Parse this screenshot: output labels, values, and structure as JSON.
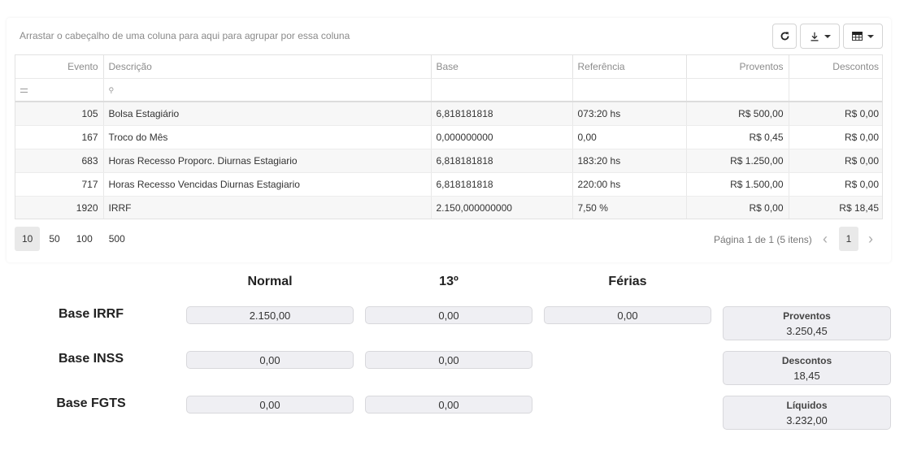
{
  "grid": {
    "group_hint": "Arrastar o cabeçalho de uma coluna para aqui para agrupar por essa coluna",
    "columns": [
      "Evento",
      "Descrição",
      "Base",
      "Referência",
      "Proventos",
      "Descontos"
    ],
    "rows": [
      {
        "evento": "105",
        "descricao": "Bolsa Estagiário",
        "base": "6,818181818",
        "referencia": "073:20 hs",
        "proventos": "R$ 500,00",
        "descontos": "R$ 0,00"
      },
      {
        "evento": "167",
        "descricao": "Troco do Mês",
        "base": "0,000000000",
        "referencia": "0,00",
        "proventos": "R$ 0,45",
        "descontos": "R$ 0,00"
      },
      {
        "evento": "683",
        "descricao": "Horas Recesso Proporc. Diurnas Estagiario",
        "base": "6,818181818",
        "referencia": "183:20 hs",
        "proventos": "R$ 1.250,00",
        "descontos": "R$ 0,00"
      },
      {
        "evento": "717",
        "descricao": "Horas Recesso Vencidas Diurnas Estagiario",
        "base": "6,818181818",
        "referencia": "220:00 hs",
        "proventos": "R$ 1.500,00",
        "descontos": "R$ 0,00"
      },
      {
        "evento": "1920",
        "descricao": "IRRF",
        "base": "2.150,000000000",
        "referencia": "7,50 %",
        "proventos": "R$ 0,00",
        "descontos": "R$ 18,45"
      }
    ]
  },
  "pager": {
    "sizes": [
      "10",
      "50",
      "100",
      "500"
    ],
    "active_size": "10",
    "info": "Página 1 de 1 (5 itens)",
    "current_page": "1"
  },
  "summary": {
    "columns": {
      "normal": "Normal",
      "decimo": "13º",
      "ferias": "Férias"
    },
    "rows": {
      "irrf": {
        "label": "Base IRRF",
        "normal": "2.150,00",
        "decimo": "0,00",
        "ferias": "0,00"
      },
      "inss": {
        "label": "Base INSS",
        "normal": "0,00",
        "decimo": "0,00"
      },
      "fgts": {
        "label": "Base FGTS",
        "normal": "0,00",
        "decimo": "0,00"
      }
    },
    "totals": {
      "proventos": {
        "label": "Proventos",
        "value": "3.250,45"
      },
      "descontos": {
        "label": "Descontos",
        "value": "18,45"
      },
      "liquidos": {
        "label": "Líquidos",
        "value": "3.232,00"
      }
    }
  },
  "icons": {
    "refresh": "refresh-icon",
    "export": "download-icon",
    "columns": "grid-columns-icon"
  }
}
